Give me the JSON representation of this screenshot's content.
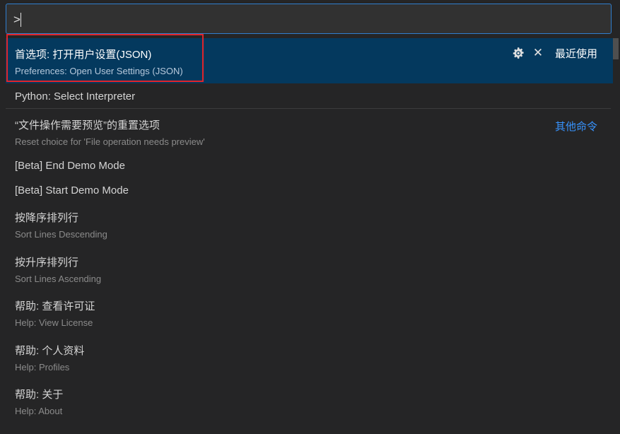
{
  "input": {
    "value": ">",
    "placeholder": ""
  },
  "items": [
    {
      "primary": "首选项: 打开用户设置(JSON)",
      "secondary": "Preferences: Open User Settings (JSON)",
      "badge": "最近使用"
    },
    {
      "primary": "Python: Select Interpreter"
    },
    {
      "primary": "“文件操作需要预览”的重置选项",
      "secondary": "Reset choice for 'File operation needs preview'",
      "badge": "其他命令"
    },
    {
      "primary": "[Beta] End Demo Mode"
    },
    {
      "primary": "[Beta] Start Demo Mode"
    },
    {
      "primary": "按降序排列行",
      "secondary": "Sort Lines Descending"
    },
    {
      "primary": "按升序排列行",
      "secondary": "Sort Lines Ascending"
    },
    {
      "primary": "帮助: 查看许可证",
      "secondary": "Help: View License"
    },
    {
      "primary": "帮助: 个人资料",
      "secondary": "Help: Profiles"
    },
    {
      "primary": "帮助: 关于",
      "secondary": "Help: About"
    }
  ],
  "icons": {
    "gear": "gear-icon",
    "close": "close-icon"
  }
}
